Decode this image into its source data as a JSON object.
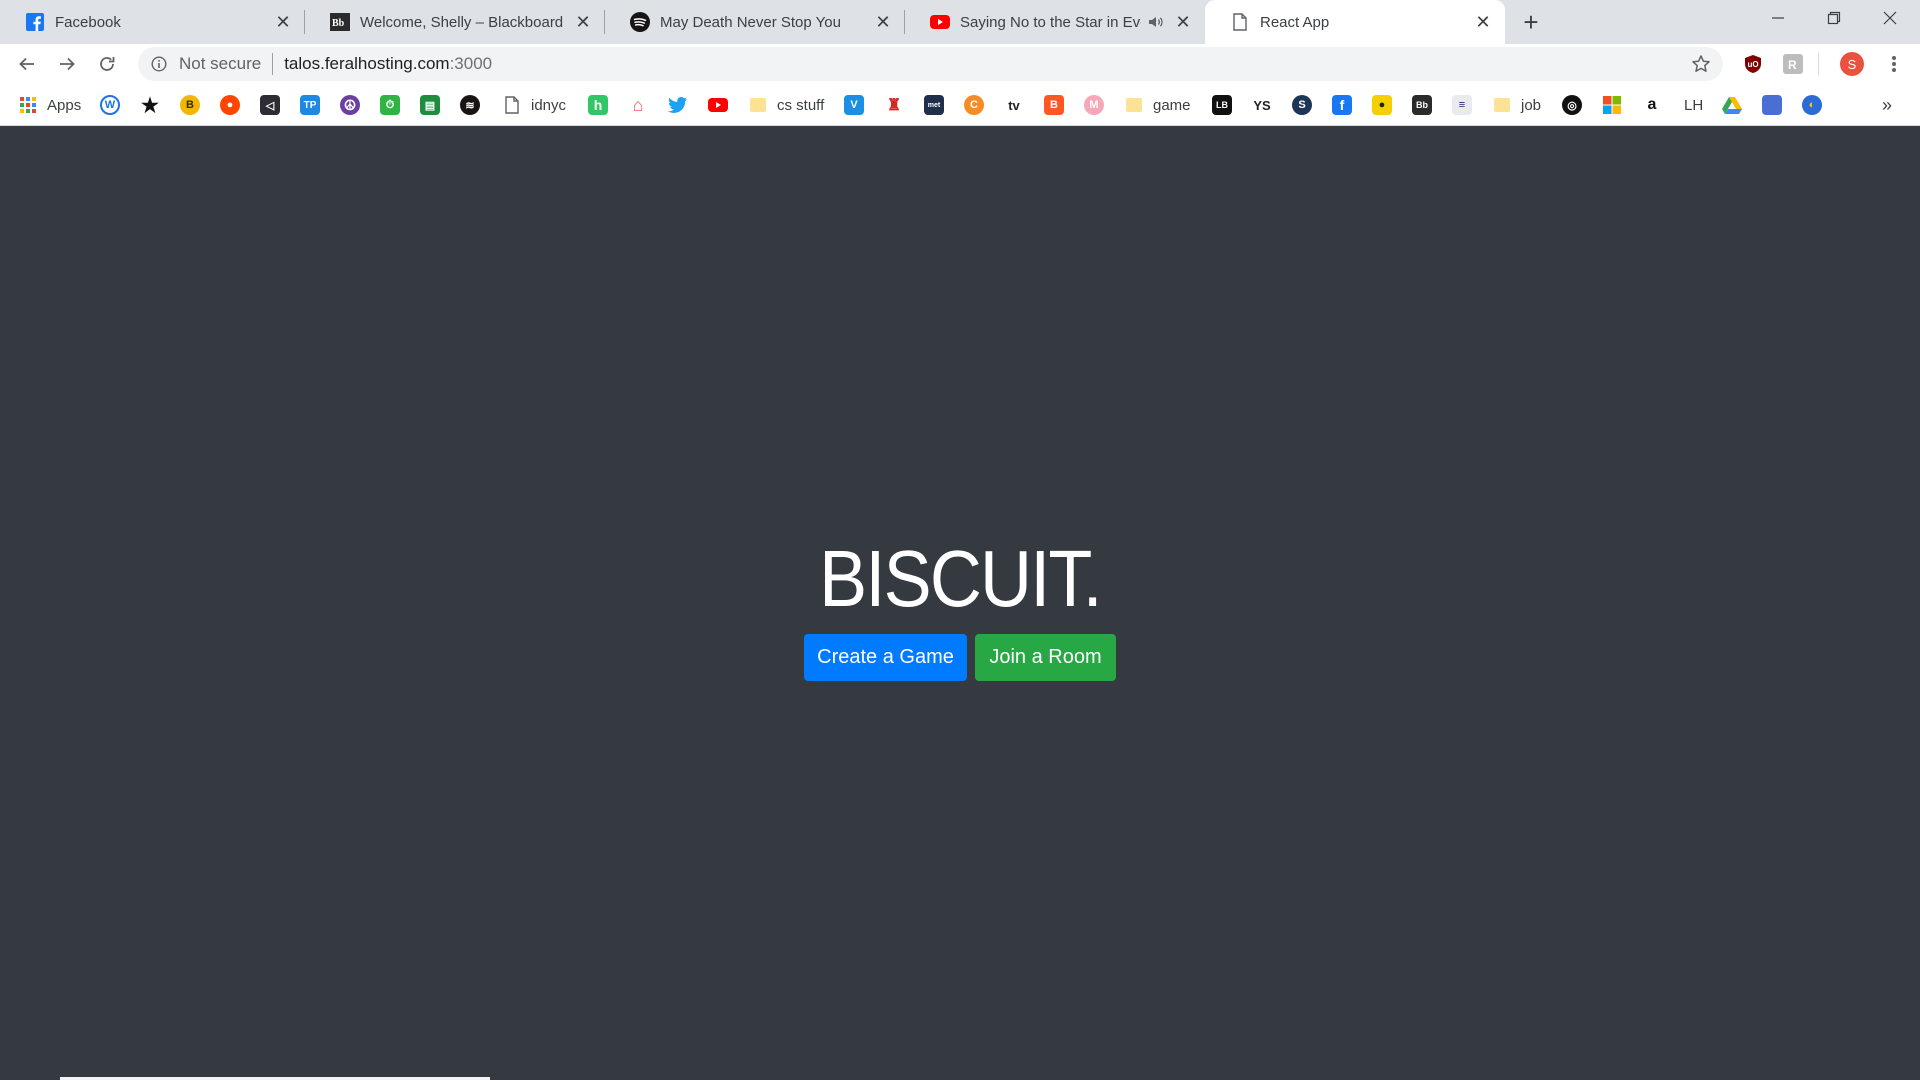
{
  "browser": {
    "tabs": [
      {
        "title": "Facebook",
        "icon": "facebook-icon"
      },
      {
        "title": "Welcome, Shelly – Blackboard Learn",
        "icon": "blackboard-icon"
      },
      {
        "title": "May Death Never Stop You",
        "icon": "spotify-icon"
      },
      {
        "title": "Saying No to the Star in Every",
        "icon": "youtube-icon",
        "audio": true
      },
      {
        "title": "React App",
        "icon": "page-icon",
        "active": true
      }
    ],
    "address": {
      "security_label": "Not secure",
      "host": "talos.feralhosting.com",
      "port": ":3000"
    },
    "profile_initial": "S",
    "bookmarks": [
      {
        "label": "Apps",
        "icon": "apps-grid-icon"
      },
      {
        "label": "",
        "icon": "w-icon"
      },
      {
        "label": "",
        "icon": "star-icon"
      },
      {
        "label": "",
        "icon": "bitcoin-icon"
      },
      {
        "label": "",
        "icon": "reddit-icon"
      },
      {
        "label": "",
        "icon": "vscode-icon"
      },
      {
        "label": "",
        "icon": "tp-icon"
      },
      {
        "label": "",
        "icon": "peace-icon"
      },
      {
        "label": "",
        "icon": "timer-icon"
      },
      {
        "label": "",
        "icon": "sheets-icon"
      },
      {
        "label": "",
        "icon": "spotify-icon"
      },
      {
        "label": "idnyc",
        "icon": "page-icon"
      },
      {
        "label": "",
        "icon": "h-icon"
      },
      {
        "label": "",
        "icon": "airbnb-icon"
      },
      {
        "label": "",
        "icon": "twitter-icon"
      },
      {
        "label": "",
        "icon": "youtube-icon"
      },
      {
        "label": "cs stuff",
        "icon": "folder-icon"
      },
      {
        "label": "",
        "icon": "v-icon"
      },
      {
        "label": "",
        "icon": "mario-icon"
      },
      {
        "label": "",
        "icon": "metmuseum-icon"
      },
      {
        "label": "",
        "icon": "crunchyroll-icon"
      },
      {
        "label": "",
        "icon": "tv-icon"
      },
      {
        "label": "",
        "icon": "blogger-icon"
      },
      {
        "label": "",
        "icon": "m-icon"
      },
      {
        "label": "game",
        "icon": "folder-icon"
      },
      {
        "label": "",
        "icon": "letterboxd-icon"
      },
      {
        "label": "",
        "icon": "ys-icon"
      },
      {
        "label": "",
        "icon": "s-circle-icon"
      },
      {
        "label": "",
        "icon": "facebook-icon"
      },
      {
        "label": "",
        "icon": "bee-icon"
      },
      {
        "label": "",
        "icon": "blackboard-icon"
      },
      {
        "label": "",
        "icon": "doc-icon"
      },
      {
        "label": "job",
        "icon": "folder-icon"
      },
      {
        "label": "",
        "icon": "compass-icon"
      },
      {
        "label": "",
        "icon": "microsoft-icon"
      },
      {
        "label": "",
        "icon": "amazon-icon"
      },
      {
        "label": "LH",
        "icon": "text-icon"
      },
      {
        "label": "",
        "icon": "drive-icon"
      },
      {
        "label": "",
        "icon": "blue-square-icon"
      },
      {
        "label": "",
        "icon": "globe-icon"
      }
    ]
  },
  "app": {
    "logo_text": "BISCUIT.",
    "create_button": "Create a Game",
    "join_button": "Join a Room"
  },
  "colors": {
    "page_bg": "#343a40",
    "primary": "#007bff",
    "success": "#28a745",
    "profile": "#e8533f"
  }
}
